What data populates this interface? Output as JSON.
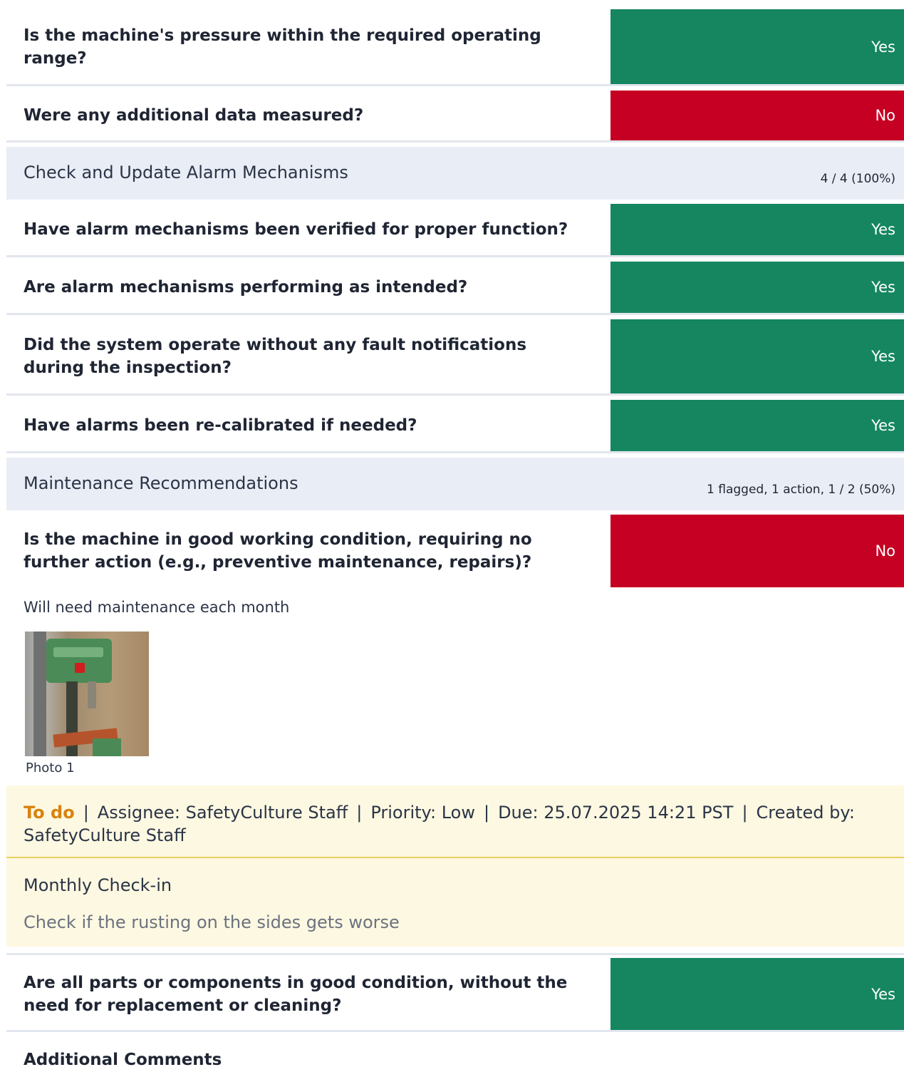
{
  "questions": [
    {
      "text": "Is the machine's pressure within the required operating range?",
      "answer": "Yes"
    },
    {
      "text": "Were any additional data measured?",
      "answer": "No"
    }
  ],
  "sections": [
    {
      "title": "Check and Update Alarm Mechanisms",
      "stats": "4 / 4 (100%)",
      "questions": [
        {
          "text": "Have alarm mechanisms been verified for proper function?",
          "answer": "Yes"
        },
        {
          "text": "Are alarm mechanisms performing as intended?",
          "answer": "Yes"
        },
        {
          "text": "Did the system operate without any fault notifications during the inspection?",
          "answer": "Yes"
        },
        {
          "text": "Have alarms been re-calibrated if needed?",
          "answer": "Yes"
        }
      ]
    },
    {
      "title": "Maintenance Recommendations",
      "stats": "1 flagged, 1 action, 1 / 2 (50%)",
      "questions": [
        {
          "text": "Is the machine in good working condition, requiring no further action (e.g., preventive maintenance, repairs)?",
          "answer": "No"
        },
        {
          "text": "Are all parts or components in good condition, without the need for replacement or cleaning?",
          "answer": "Yes"
        }
      ],
      "note": "Will need maintenance each month",
      "photo_caption": "Photo 1",
      "action": {
        "status": "To do",
        "assignee": "Assignee: SafetyCulture Staff",
        "priority": "Priority: Low",
        "due": "Due: 25.07.2025 14:21 PST",
        "created": "Created by: SafetyCulture Staff",
        "separator": "|",
        "title": "Monthly Check-in",
        "description": "Check if the rusting on the sides gets worse"
      }
    }
  ],
  "additional_comments": "Additional Comments",
  "colors": {
    "yes": "#158660",
    "no": "#c60022",
    "todo": "#d9820d",
    "section_bg": "#e9edf5",
    "action_bg": "#fdf8e1"
  }
}
